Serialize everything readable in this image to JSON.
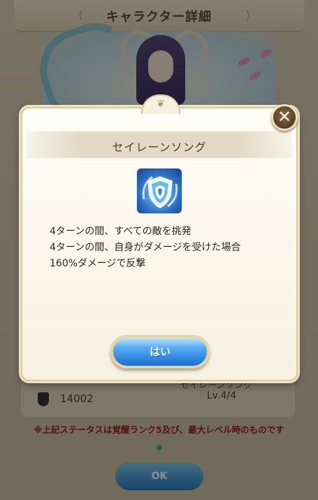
{
  "background": {
    "title": "キャラクター詳細",
    "prev_arrow": "⟨",
    "next_arrow": "⟩",
    "stat": {
      "power_value": "14002",
      "skill_name": "セイレーンソング",
      "level": "Lv.4/4"
    },
    "note": "※上記ステータスは覚醒ランク5及び、最大レベル時のものです",
    "ok_label": "OK"
  },
  "modal": {
    "ornament": "❦",
    "title": "セイレーンソング",
    "skill_icon": "shield-icon",
    "description": [
      "4ターンの間、すべての敵を挑発",
      "4ターンの間、自身がダメージを受けた場合",
      "160%ダメージで反撃"
    ],
    "confirm_label": "はい",
    "close_glyph": "✕"
  },
  "colors": {
    "accent_blue": "#1b6ed0",
    "gold_border": "#e8d59e",
    "note_red": "#a02020"
  }
}
